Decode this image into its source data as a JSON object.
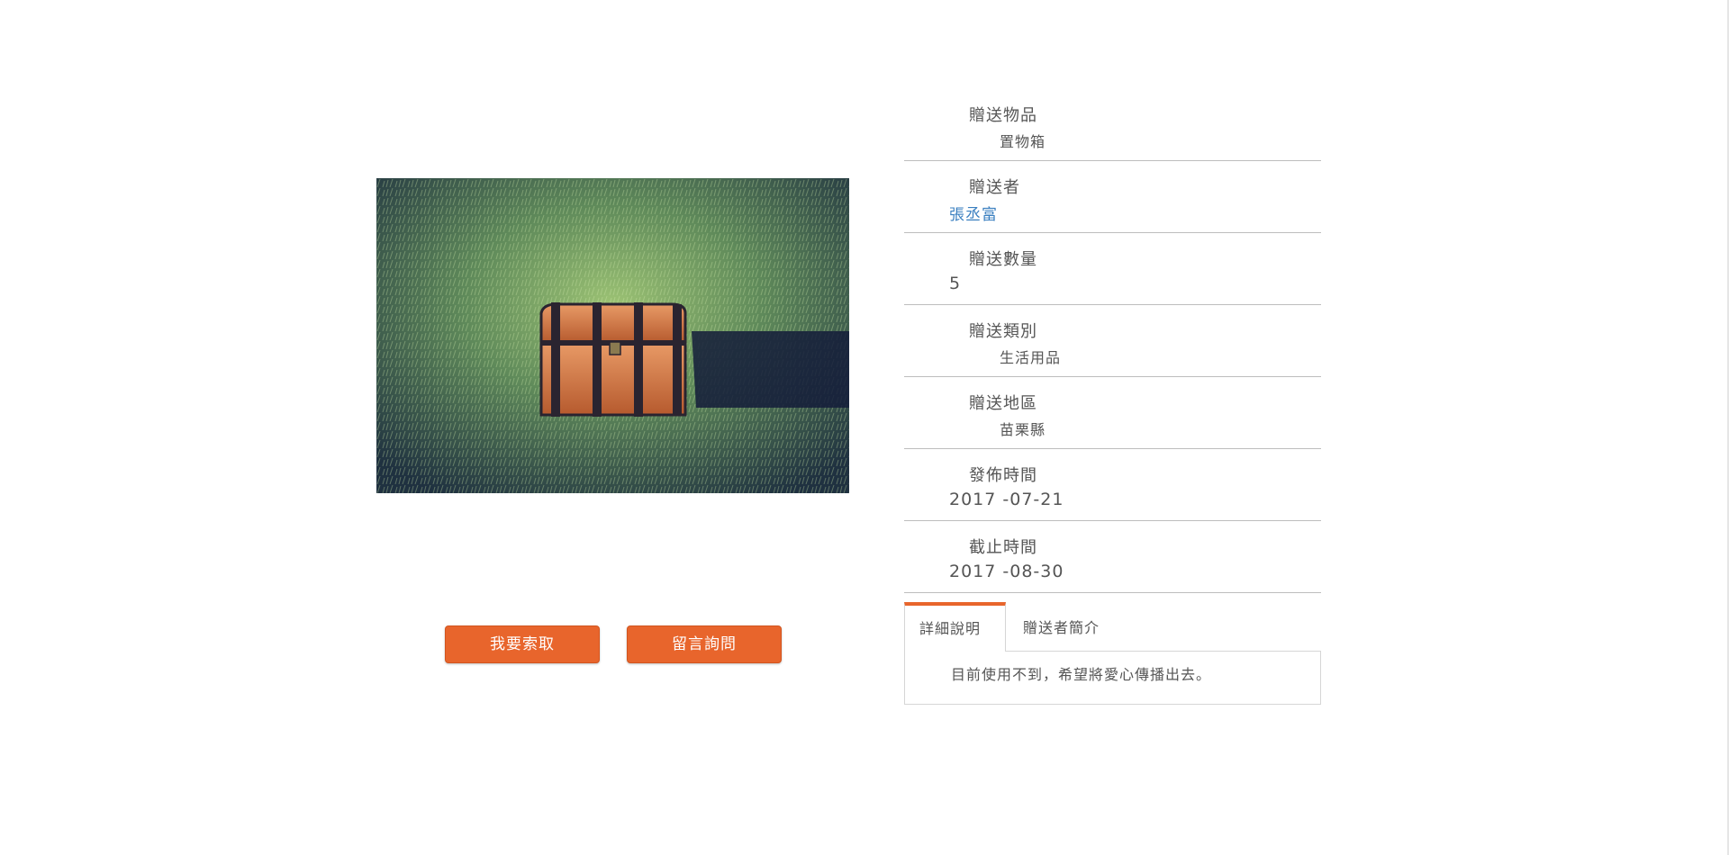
{
  "item_photo": {
    "subject": "treasure chest on grass",
    "colors": {
      "grass_dark": "#23372f",
      "grass_light": "#8fb86a",
      "wood": "#c8683a",
      "bands": "#2a2430"
    }
  },
  "actions": {
    "request_label": "我要索取",
    "message_label": "留言詢問",
    "accent_color": "#e8652c"
  },
  "details": {
    "item": {
      "label": "贈送物品",
      "value": "置物箱"
    },
    "giver": {
      "label": "贈送者",
      "value": "張丞富"
    },
    "quantity": {
      "label": "贈送數量",
      "value": "5"
    },
    "category": {
      "label": "贈送類別",
      "value": "生活用品"
    },
    "region": {
      "label": "贈送地區",
      "value": "苗栗縣"
    },
    "posted": {
      "label": "發佈時間",
      "value": "2017 -07-21"
    },
    "deadline": {
      "label": "截止時間",
      "value": "2017 -08-30"
    }
  },
  "tabs": {
    "items": [
      {
        "label": "詳細說明",
        "active": true
      },
      {
        "label": "贈送者簡介",
        "active": false
      }
    ],
    "panel_text": "目前使用不到，希望將愛心傳播出去。"
  }
}
